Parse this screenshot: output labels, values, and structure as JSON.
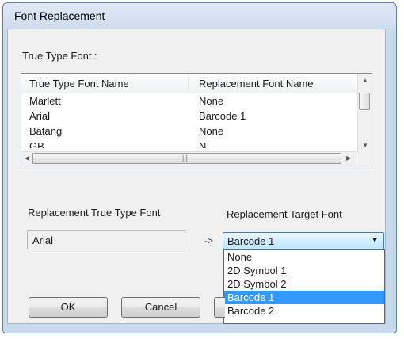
{
  "dialog": {
    "title": "Font Replacement",
    "section_label": "True Type Font :",
    "list": {
      "columns": [
        "True Type Font Name",
        "Replacement Font Name"
      ],
      "rows": [
        {
          "name": "Marlett",
          "replacement": "None"
        },
        {
          "name": "Arial",
          "replacement": "Barcode 1"
        },
        {
          "name": "Batang",
          "replacement": "None"
        },
        {
          "name": "GB...",
          "replacement": "N..."
        }
      ]
    },
    "replacement_ttf_label": "Replacement True Type Font",
    "replacement_target_label": "Replacement Target Font",
    "ttf_value": "Arial",
    "arrow_text": "->",
    "target_selected": "Barcode 1",
    "target_options": [
      "None",
      "2D Symbol 1",
      "2D Symbol 2",
      "Barcode 1",
      "Barcode 2"
    ],
    "selected_option_index": 3,
    "buttons": {
      "ok": "OK",
      "cancel": "Cancel"
    }
  },
  "colors": {
    "selection": "#3399ff",
    "combo_border": "#3c7fb1"
  }
}
